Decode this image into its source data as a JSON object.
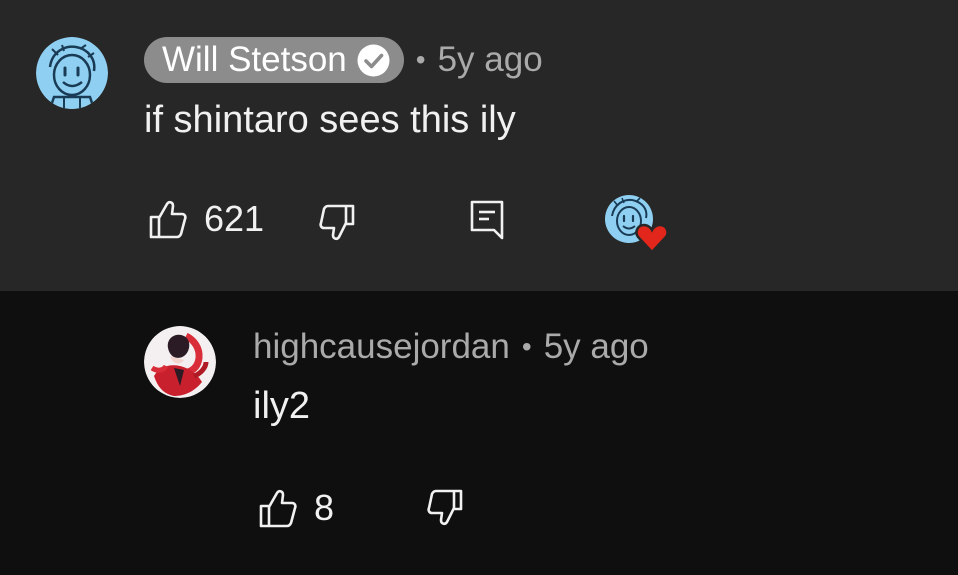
{
  "top_comment": {
    "author": "Will Stetson",
    "verified": true,
    "separator": "•",
    "time": "5y ago",
    "text": "if shintaro sees this ily",
    "like_count": "621",
    "icons": {
      "avatar": "cartoon-face-avatar",
      "verified": "check-circle-icon",
      "like": "thumb-up-icon",
      "dislike": "thumb-down-icon",
      "reply": "reply-comment-icon",
      "hearted": "creator-heart-badge"
    }
  },
  "reply_comment": {
    "author": "highcausejordan",
    "separator": "•",
    "time": "5y ago",
    "text": "ily2",
    "like_count": "8",
    "icons": {
      "avatar": "anime-character-avatar",
      "like": "thumb-up-icon",
      "dislike": "thumb-down-icon"
    }
  },
  "colors": {
    "top_background": "#272727",
    "reply_background": "#0f0f0f",
    "author_chip": "#8c8c8c",
    "secondary_text": "#aaaaaa",
    "heart": "#e3261b",
    "avatar_blue": "#8fd0f2"
  }
}
